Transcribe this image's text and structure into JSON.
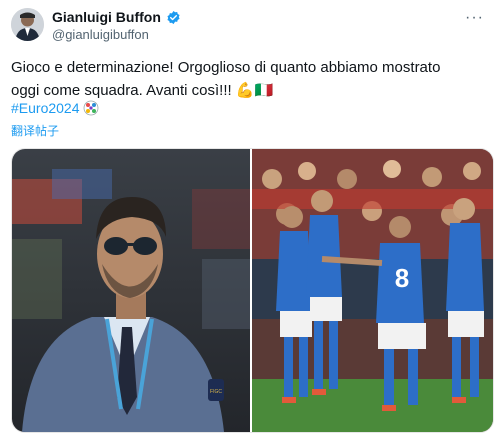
{
  "author": {
    "name": "Gianluigi Buffon",
    "handle": "@gianluigibuffon",
    "verified": true
  },
  "tweet": {
    "text": "Gioco e determinazione! Orgoglioso di quanto abbiamo mostrato oggi come squadra. Avanti così!!! 💪🇮🇹",
    "hashtag": "#Euro2024",
    "translate_label": "翻译帖子"
  },
  "media": {
    "photo1": {
      "crest_text": "FIGC"
    },
    "photo2": {
      "numbers": [
        "8"
      ]
    }
  },
  "colors": {
    "link": "#1d9bf0",
    "verified": "#1d9bf0",
    "italy_blue": "#2d6ec8"
  },
  "icons": [
    "verified-badge-icon",
    "more-options-icon",
    "euro2024-emoji-icon"
  ]
}
